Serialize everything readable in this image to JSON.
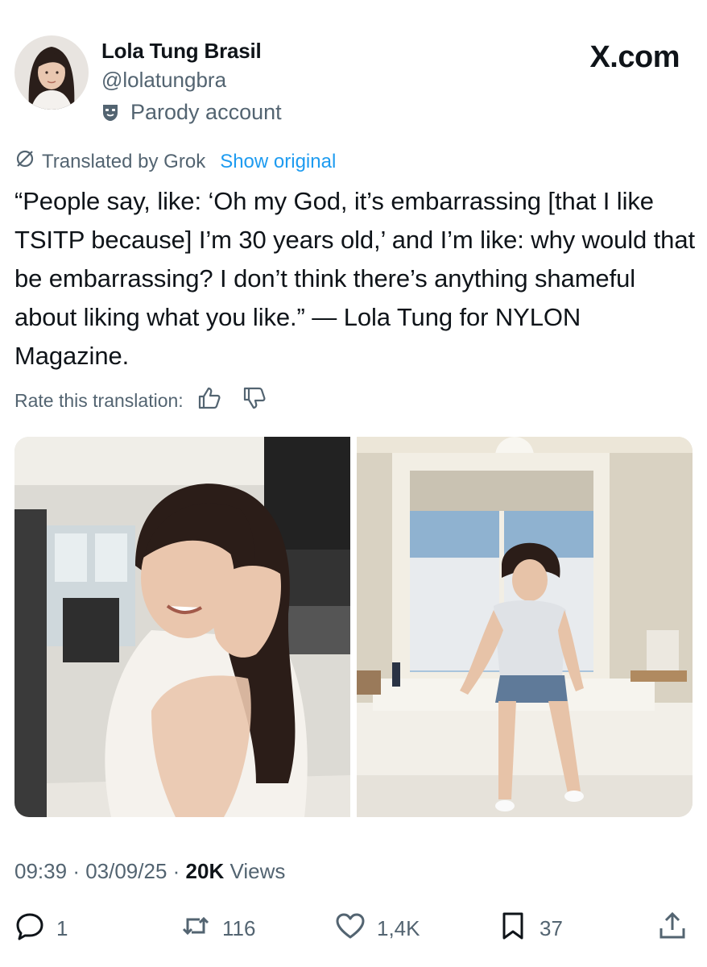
{
  "author": {
    "name": "Lola Tung Brasil",
    "handle": "@lolatungbra",
    "label": "Parody account"
  },
  "brand": "X.com",
  "translation": {
    "label": "Translated by Grok",
    "show_original": "Show original",
    "rate_label": "Rate this translation:"
  },
  "tweet": {
    "text": "“People say, like: ‘Oh my God, it’s embarrassing [that I like TSITP because] I’m 30 years old,’ and I’m like: why would that be embarrassing? I don’t think there’s anything shameful about liking what you like.” — Lola Tung for NYLON Magazine."
  },
  "meta": {
    "time": "09:39",
    "date": "03/09/25",
    "views_count": "20K",
    "views_label": "Views"
  },
  "actions": {
    "replies": "1",
    "reposts": "116",
    "likes": "1,4K",
    "bookmarks": "37"
  },
  "colors": {
    "text": "#0f1419",
    "secondary": "#536471",
    "link": "#1d9bf0"
  },
  "icons": [
    "parody-mask-icon",
    "grok-translate-icon",
    "thumbs-up-icon",
    "thumbs-down-icon",
    "reply-icon",
    "repost-icon",
    "like-icon",
    "bookmark-icon",
    "share-icon"
  ]
}
